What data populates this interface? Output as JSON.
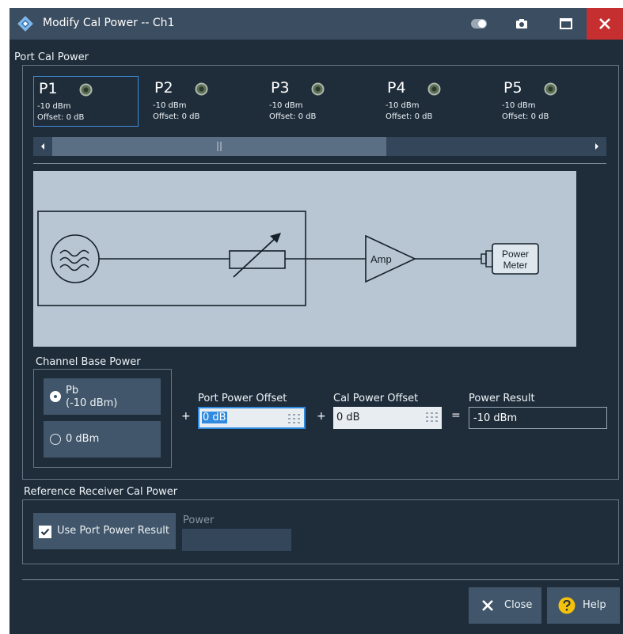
{
  "window": {
    "title": "Modify Cal Power -- Ch1"
  },
  "port_cal_power": {
    "label": "Port Cal Power",
    "ports": [
      {
        "name": "P1",
        "power": "-10 dBm",
        "offset": "Offset: 0 dB",
        "selected": true
      },
      {
        "name": "P2",
        "power": "-10 dBm",
        "offset": "Offset: 0 dB",
        "selected": false
      },
      {
        "name": "P3",
        "power": "-10 dBm",
        "offset": "Offset: 0 dB",
        "selected": false
      },
      {
        "name": "P4",
        "power": "-10 dBm",
        "offset": "Offset: 0 dB",
        "selected": false
      },
      {
        "name": "P5",
        "power": "-10 dBm",
        "offset": "Offset: 0 dB",
        "selected": false
      }
    ],
    "diagram": {
      "amp_label": "Amp",
      "meter_label_1": "Power",
      "meter_label_2": "Meter"
    }
  },
  "channel_base_power": {
    "label": "Channel Base Power",
    "option_pb_1": "Pb",
    "option_pb_2": "(-10 dBm)",
    "option_zero": "0 dBm",
    "selected": "pb"
  },
  "offsets": {
    "port_power_offset_label": "Port Power Offset",
    "port_power_offset_value": "0 dB",
    "cal_power_offset_label": "Cal Power Offset",
    "cal_power_offset_value": "0 dB",
    "power_result_label": "Power Result",
    "power_result_value": "-10 dBm",
    "plus": "+",
    "equals": "="
  },
  "reference_receiver": {
    "label": "Reference Receiver Cal Power",
    "use_port_power_result": "Use Port Power Result",
    "checked": true,
    "power_label": "Power",
    "power_value": ""
  },
  "buttons": {
    "close": "Close",
    "help": "Help"
  },
  "colors": {
    "accent": "#2f8ae0",
    "close_red": "#c62f2f",
    "help_yellow": "#f4c20d",
    "background": "#1f2d3b"
  }
}
